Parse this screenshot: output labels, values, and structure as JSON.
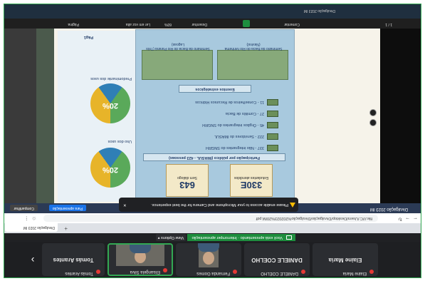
{
  "participants": [
    {
      "name": "Elaine Maria",
      "label": "Elaine Maria"
    },
    {
      "name": "DANIELE COELHO",
      "label": "DANIELE COELHO"
    },
    {
      "name": "Fernanda Gomes",
      "label": ""
    },
    {
      "name": "Elisangela Silva",
      "label": ""
    },
    {
      "name": "Tomás Arantes",
      "label": "Tomás Arantes"
    }
  ],
  "meet": {
    "banner": "Você está apresentando · Interromper apresentação",
    "view_options": "View Options"
  },
  "browser": {
    "tab_title": "Divulgação 2023 IM",
    "url": "file:///C:/Users/Desktop/Divulgação/Divulgação%202023%20IM.pdf"
  },
  "doc": {
    "title": "Divulgação 2023 IM",
    "pill1": "Para apresentação",
    "pill2": "Compartilhar"
  },
  "toast": {
    "text": "Please enable access to your Microphone and Camera for the best experience."
  },
  "poster": {
    "stat1_value": "330E",
    "stat1_label": "Estudantes atendidos",
    "stat2_value": "643",
    "stat2_label": "Sem diálogo",
    "section1": "Participação por público (IMASUL - 423 pessoas)",
    "items": [
      "337 - Não integrantes do SNGRH",
      "222 - Servidores do IMASUL",
      "45 - Órgãos integrantes do SNGRH",
      "27 - Comitês de Bacia",
      "11 - Conselheiros de Recursos Hídricos"
    ],
    "section2": "Eventos estratégicos",
    "event1": "Seminário da Bacia do Rio Ivinhema (Naviraí)",
    "event2": "Seminário da Bacia do Rio Paraná (Três Lagoas)"
  },
  "leftpanel": {
    "pct1": "20%",
    "pct2": "20%",
    "label1": "Uso dos usos",
    "label2": "Predominante dos usos",
    "page_label": "Pág1"
  },
  "page_badge": "1 / 1",
  "toolbar": {
    "zoom": "60%",
    "comment": "Comentar",
    "draw": "Desenhar",
    "read": "Ler em voz alta",
    "page": "Página"
  },
  "colors": {
    "meet_green": "#1e8e3e",
    "accent_blue": "#1a73e8"
  }
}
